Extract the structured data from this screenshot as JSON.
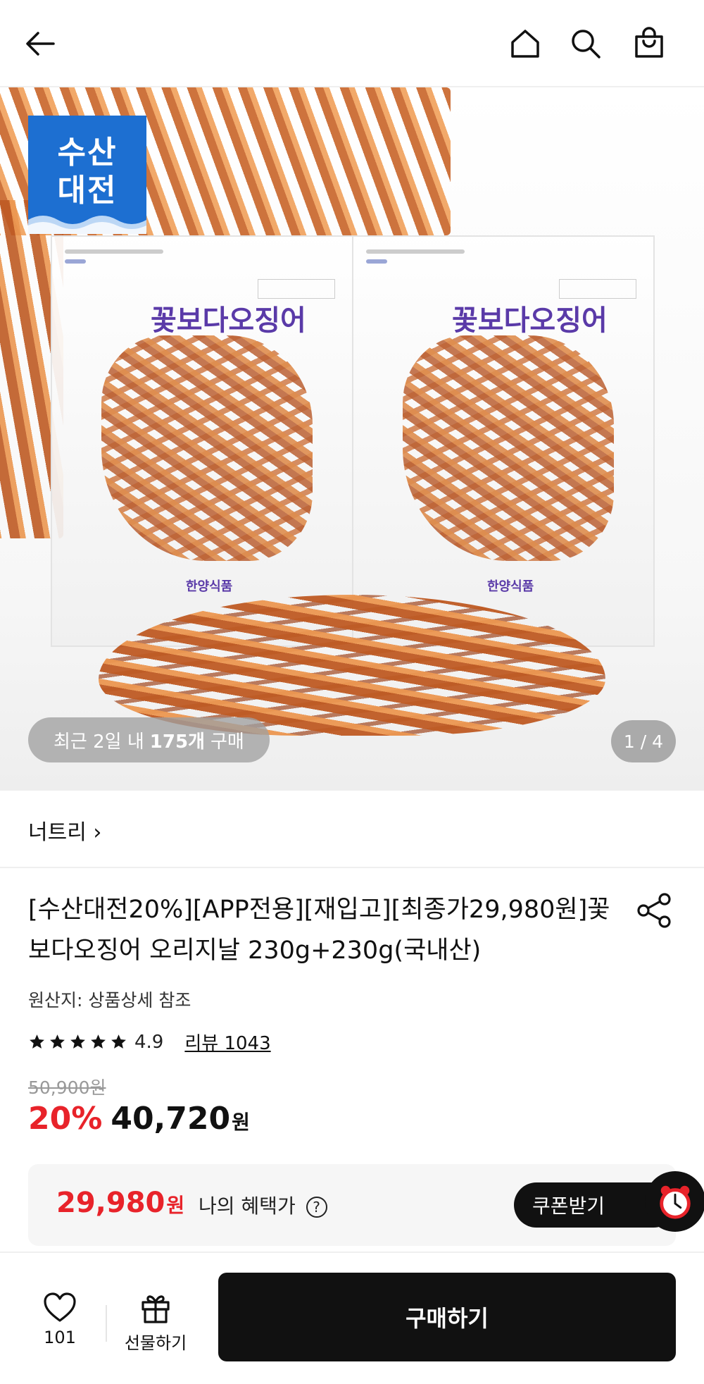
{
  "header": {
    "icons": [
      "back-arrow-icon",
      "home-icon",
      "search-icon",
      "shopping-bag-icon"
    ]
  },
  "hero": {
    "badge_line1": "수산",
    "badge_line2": "대전",
    "package_title": "꽃보다오징어",
    "package_brand": "한양식품",
    "recent_prefix": "최근 2일 내",
    "recent_count": "175개",
    "recent_suffix": "구매",
    "counter": "1 / 4"
  },
  "brand": {
    "label": "너트리 ›"
  },
  "product": {
    "title": "[수산대전20%][APP전용][재입고][최종가29,980원]꽃보다오징어 오리지날 230g+230g(국내산)",
    "origin": "원산지: 상품상세 참조",
    "rating": "4.9",
    "stars": 5,
    "reviews": "리뷰 1043",
    "original_price": "50,900원",
    "discount": "20%",
    "price": "40,720",
    "price_unit": "원"
  },
  "benefit": {
    "price": "29,980",
    "unit": "원",
    "label": "나의 혜택가",
    "help": "?",
    "coupon_label": "쿠폰받기"
  },
  "bottom": {
    "like_count": "101",
    "gift_label": "선물하기",
    "buy_label": "구매하기"
  },
  "colors": {
    "accent_red": "#e8232a",
    "badge_blue": "#1d6fd1",
    "button_black": "#111111"
  }
}
